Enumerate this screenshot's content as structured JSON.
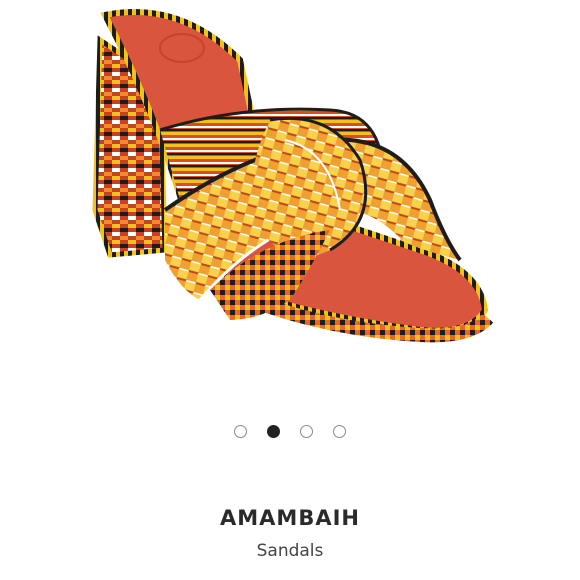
{
  "gallery": {
    "image_alt": "Woven sandal",
    "pagination": [
      {
        "active": false
      },
      {
        "active": true
      },
      {
        "active": false
      },
      {
        "active": false
      }
    ]
  },
  "product": {
    "brand": "AMAMBAIH",
    "category": "Sandals"
  },
  "colors": {
    "insole": "#d9553d",
    "weave_orange": "#e8681e",
    "weave_yellow": "#f2c21b",
    "weave_black": "#1d1d1d",
    "dot_active": "#222222",
    "dot_inactive_border": "#8a8a8a"
  }
}
